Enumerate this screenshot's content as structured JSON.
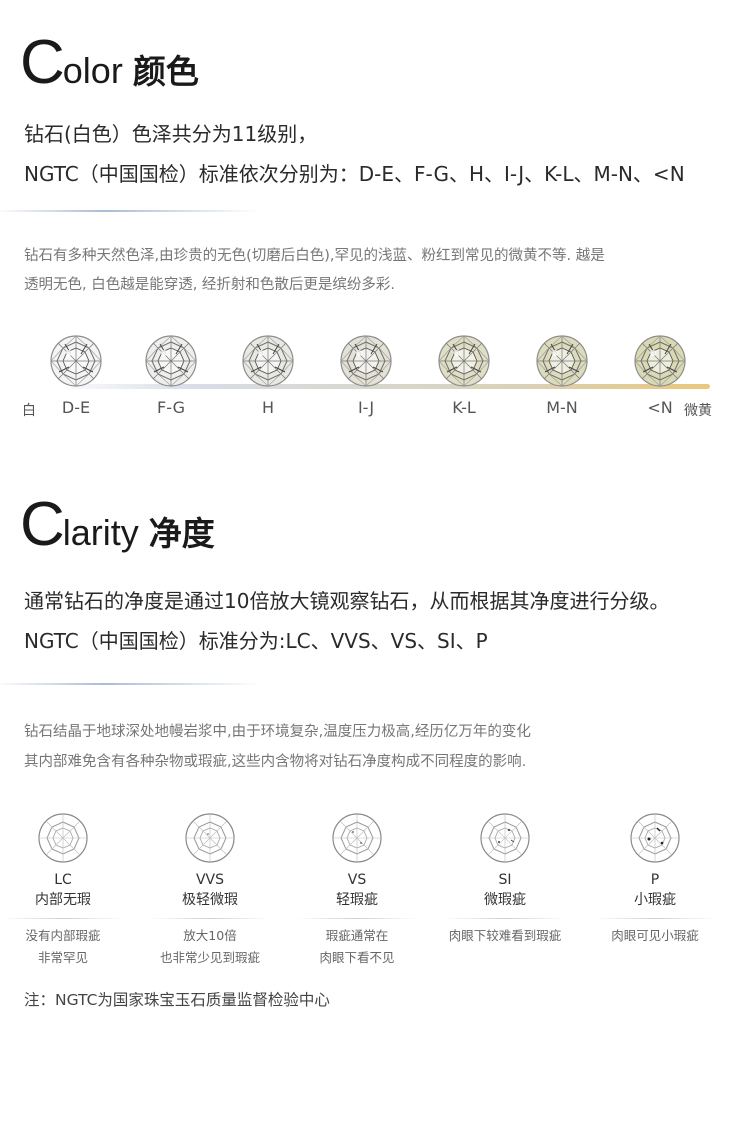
{
  "color_section": {
    "heading_cap": "C",
    "heading_rest": "olor",
    "heading_cn": "颜色",
    "intro_line1": "钻石(白色）色泽共分为11级别，",
    "intro_line2": "NGTC（中国国检）标准依次分别为：D-E、F-G、H、I-J、K-L、M-N、<N",
    "desc_line1": "钻石有多种天然色泽,由珍贵的无色(切磨后白色),罕见的浅蓝、粉红到常见的微黄不等. 越是",
    "desc_line2": "透明无色, 白色越是能穿透, 经折射和色散后更是缤纷多彩.",
    "left_label": "白",
    "right_label": "微黄",
    "grades": [
      {
        "label": "D-E",
        "tint": "#f4f4f4"
      },
      {
        "label": "F-G",
        "tint": "#eeeeec"
      },
      {
        "label": "H",
        "tint": "#e9e9e4"
      },
      {
        "label": "I-J",
        "tint": "#e4e2d6"
      },
      {
        "label": "K-L",
        "tint": "#e0dfc6"
      },
      {
        "label": "M-N",
        "tint": "#dcdcbd"
      },
      {
        "label": "<N",
        "tint": "#d9d9b4"
      }
    ]
  },
  "clarity_section": {
    "heading_cap": "C",
    "heading_rest": "larity",
    "heading_cn": "净度",
    "intro_line1": "通常钻石的净度是通过10倍放大镜观察钻石，从而根据其净度进行分级。",
    "intro_line2": "NGTC（中国国检）标准分为:LC、VVS、VS、SI、P",
    "desc_line1": "钻石结晶于地球深处地幔岩浆中,由于环境复杂,温度压力极高,经历亿万年的变化",
    "desc_line2": "其内部难免含有各种杂物或瑕疵,这些内含物将对钻石净度构成不同程度的影响.",
    "grades": [
      {
        "code": "LC",
        "name": "内部无瑕",
        "desc1": "没有内部瑕疵",
        "desc2": "非常罕见"
      },
      {
        "code": "VVS",
        "name": "极轻微瑕",
        "desc1": "放大10倍",
        "desc2": "也非常少见到瑕疵"
      },
      {
        "code": "VS",
        "name": "轻瑕疵",
        "desc1": "瑕疵通常在",
        "desc2": "肉眼下看不见"
      },
      {
        "code": "SI",
        "name": "微瑕疵",
        "desc1": "肉眼下较难看到瑕疵",
        "desc2": ""
      },
      {
        "code": "P",
        "name": "小瑕疵",
        "desc1": "肉眼可见小瑕疵",
        "desc2": ""
      }
    ]
  },
  "note": "注：NGTC为国家珠宝玉石质量监督检验中心"
}
